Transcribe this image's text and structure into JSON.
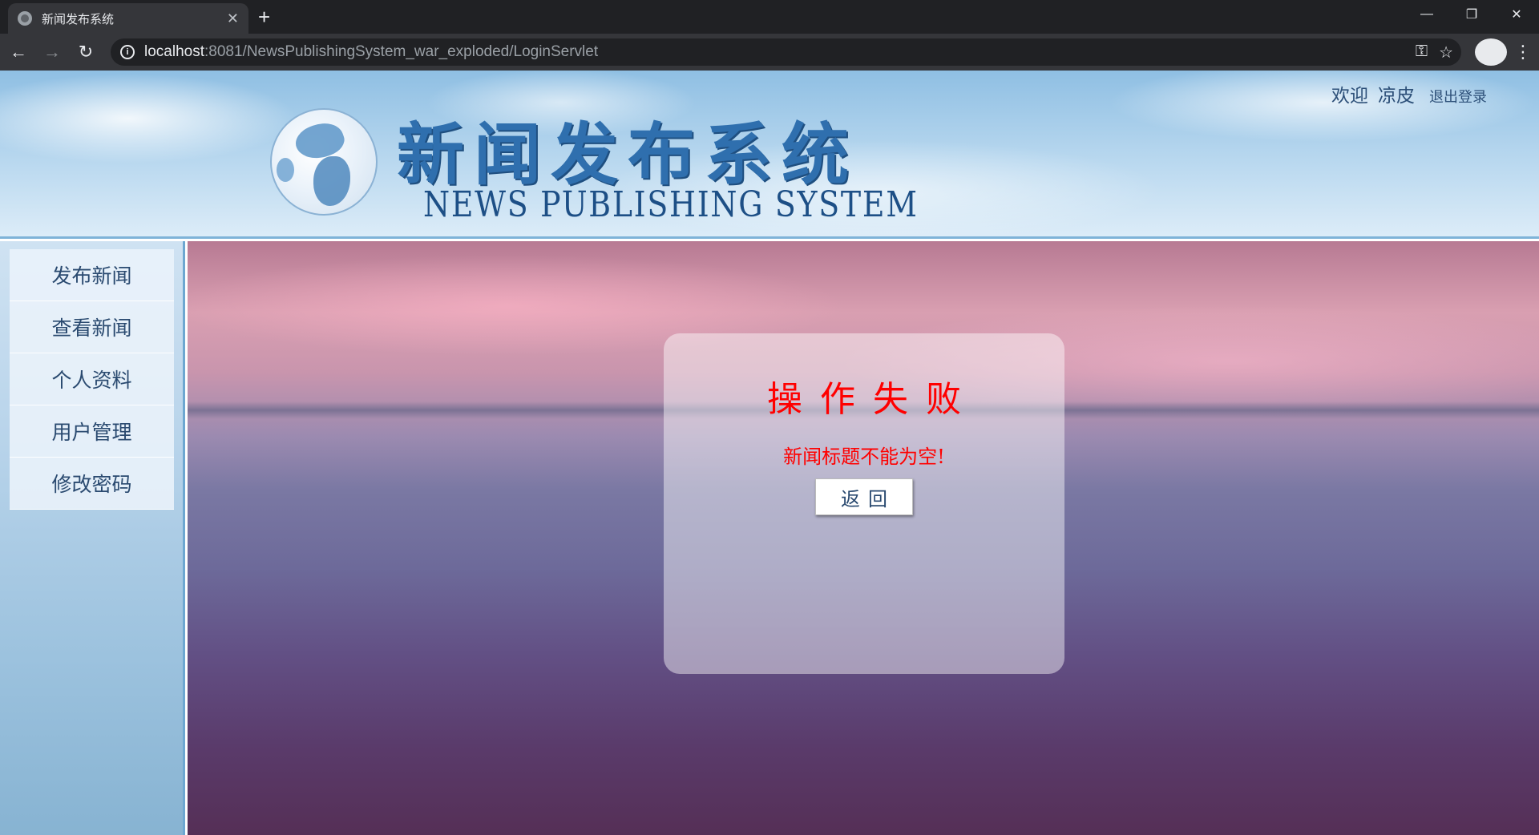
{
  "browser": {
    "tab_title": "新闻发布系统",
    "tab_close": "✕",
    "new_tab": "+",
    "window_controls": {
      "minimize": "—",
      "restore": "❐",
      "close": "✕"
    },
    "nav": {
      "back": "←",
      "forward": "→",
      "reload": "↻"
    },
    "url_host": "localhost",
    "url_rest": ":8081/NewsPublishingSystem_war_exploded/LoginServlet",
    "key_icon": "⚿",
    "star_icon": "☆",
    "menu_icon": "⋮"
  },
  "header": {
    "title": "新闻发布系统",
    "subtitle": "NEWS PUBLISHING SYSTEM",
    "welcome": "欢迎",
    "username": "凉皮",
    "logout": "退出登录"
  },
  "sidebar": {
    "items": [
      {
        "label": "发布新闻"
      },
      {
        "label": "查看新闻"
      },
      {
        "label": "个人资料"
      },
      {
        "label": "用户管理"
      },
      {
        "label": "修改密码"
      }
    ]
  },
  "dialog": {
    "title": "操作失败",
    "message": "新闻标题不能为空!",
    "back_button": "返回"
  },
  "colors": {
    "error_text": "#ff0000",
    "header_title": "#2f6fae",
    "menu_text": "#2a4a70"
  }
}
